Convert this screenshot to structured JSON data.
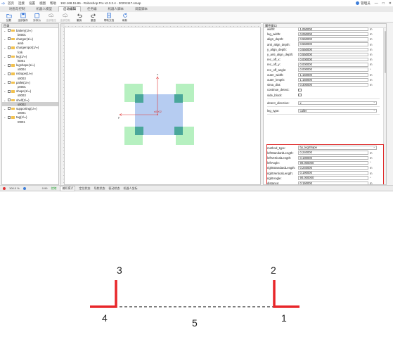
{
  "app": {
    "title": "192.168.15.86 - Roboshop Pro v2.3.2.4 - 20201117.smap",
    "menu": [
      "首页",
      "连接",
      "设置",
      "视图",
      "帮助"
    ],
    "user": "管理员",
    "window_buttons": [
      "—",
      "□",
      "✕"
    ]
  },
  "ribbon": {
    "tabs": [
      "地图与控制",
      "机器人模型",
      "启动编辑",
      "任务编",
      "机器人脚本",
      "调度脚本"
    ],
    "active_tab": 2
  },
  "toolbar": {
    "tools": [
      {
        "label": "加载",
        "icon": "open-folder-icon",
        "disabled": false
      },
      {
        "label": "全部保存",
        "icon": "save-icon",
        "disabled": false
      },
      {
        "label": "另存为",
        "icon": "save-as-icon",
        "disabled": false
      },
      {
        "label": "全部推送",
        "icon": "upload-cloud-icon",
        "disabled": true
      },
      {
        "label": "全部拉取",
        "icon": "download-cloud-icon",
        "disabled": true
      },
      {
        "label": "撤销",
        "icon": "undo-icon",
        "disabled": false
      },
      {
        "label": "重做",
        "icon": "redo-icon",
        "disabled": false
      },
      {
        "label": "帮助文档",
        "icon": "help-doc-icon",
        "disabled": false
      },
      {
        "label": "刷新",
        "icon": "refresh-icon",
        "disabled": false
      }
    ]
  },
  "left_panel": {
    "header": "目录",
    "tree": [
      {
        "label": "battery(1/∞)",
        "children": [
          "b0001"
        ]
      },
      {
        "label": "charger(1/∞)",
        "children": [
          "amb"
        ]
      },
      {
        "label": "chargerspot(1/∞)",
        "children": [
          "fork"
        ]
      },
      {
        "label": "leg(1/∞)",
        "children": [
          "l0001"
        ]
      },
      {
        "label": "legshape(1/∞)",
        "children": [
          "x0004"
        ]
      },
      {
        "label": "nshape(1/∞)",
        "children": [
          "s0003"
        ]
      },
      {
        "label": "pallet(1/∞)",
        "children": [
          "p0001"
        ]
      },
      {
        "label": "shape(1/∞)",
        "children": [
          "s0003"
        ]
      },
      {
        "label": "shelf(1/∞)",
        "children": [
          "s0002"
        ]
      },
      {
        "label": "supporting(1/∞)",
        "children": [
          "s0001"
        ]
      },
      {
        "label": "tag(1/∞)",
        "children": [
          "t0001"
        ]
      }
    ],
    "selected": "s0002"
  },
  "canvas": {
    "axis_x_label": "y",
    "axis_y_label": "x",
    "center_label": "s0002"
  },
  "properties": {
    "header": "属性窗口",
    "rows_top": [
      {
        "label": "width:",
        "value": "1.050000",
        "unit": "m"
      },
      {
        "label": "leg_width:",
        "value": "0.050000",
        "unit": "m"
      },
      {
        "label": "align_depth:",
        "value": "0.550000",
        "unit": "m"
      },
      {
        "label": "anti_align_depth:",
        "value": "0.550000",
        "unit": "m"
      },
      {
        "label": "y_align_depth:",
        "value": "0.550000",
        "unit": "m"
      },
      {
        "label": "y_anti_align_depth:",
        "value": "0.550000",
        "unit": "m"
      },
      {
        "label": "rec_off_x:",
        "value": "0.000000",
        "unit": "m"
      },
      {
        "label": "rec_off_y:",
        "value": "0.000000",
        "unit": "m"
      },
      {
        "label": "rec_off_angle:",
        "value": "0.000000",
        "unit": "°"
      },
      {
        "label": "outer_width:",
        "value": "1.150000",
        "unit": "m"
      },
      {
        "label": "outer_length:",
        "value": "1.150000",
        "unit": "m"
      },
      {
        "label": "sima_dist:",
        "value": "0.300000",
        "unit": "m"
      }
    ],
    "checks_top": [
      {
        "label": "continue_detect:",
        "checked": false
      },
      {
        "label": "side_block:",
        "checked": false
      }
    ],
    "detect_direction": {
      "label": "detect_direction:",
      "value": "x"
    },
    "leg_type": {
      "label": "leg_type:",
      "value": "caller"
    },
    "method_type": {
      "label": "method_type:",
      "value": "by_legShape"
    },
    "rows_method": [
      {
        "label": "leftStandardLength:",
        "value": "0.240000",
        "unit": "m"
      },
      {
        "label": "leftVerticalLength:",
        "value": "0.190000",
        "unit": "m"
      },
      {
        "label": "leftAngle:",
        "value": "90.000000",
        "unit": "°"
      },
      {
        "label": "rightStandardLength:",
        "value": "0.240000",
        "unit": "m"
      },
      {
        "label": "rightVerticalLength:",
        "value": "0.190000",
        "unit": "m"
      },
      {
        "label": "rightAngle:",
        "value": "90.000000",
        "unit": "°"
      },
      {
        "label": "distance:",
        "value": "0.150000",
        "unit": "m"
      }
    ],
    "drift": {
      "label": "drift:",
      "checked": true
    }
  },
  "statusbar": {
    "zoom": "100.0 %",
    "value": "0.99",
    "green": "就绪",
    "modes": [
      "编机模式",
      "定位状态",
      "导航状态",
      "驱动状态",
      "机器人坐标"
    ]
  },
  "diagram": {
    "labels": [
      "1",
      "2",
      "3",
      "4",
      "5"
    ],
    "color": "#e8262a"
  },
  "colors": {
    "accent_red": "#e02a2a",
    "leg_green": "#b6f0c0",
    "shelf_blue": "#aec7f0",
    "leg_dark_green": "#4aa79a"
  }
}
